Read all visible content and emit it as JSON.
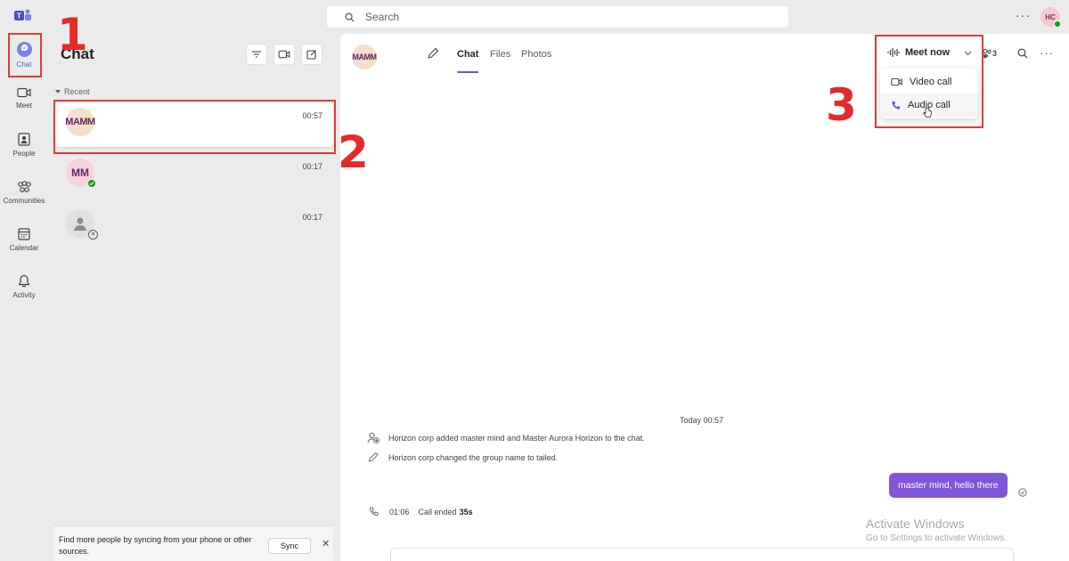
{
  "search": {
    "placeholder": "Search"
  },
  "top": {
    "more_label": "···",
    "user_initials": "HC"
  },
  "rail": [
    {
      "label": "Chat"
    },
    {
      "label": "Meet"
    },
    {
      "label": "People"
    },
    {
      "label": "Communities"
    },
    {
      "label": "Calendar"
    },
    {
      "label": "Activity"
    }
  ],
  "list": {
    "title": "Chat",
    "section": "Recent",
    "items": [
      {
        "avatar": "MAMM",
        "time": "00:57"
      },
      {
        "avatar": "MM",
        "time": "00:17"
      },
      {
        "avatar": "",
        "time": "00:17"
      }
    ],
    "sync_text": "Find more people by syncing from your phone or other sources.",
    "sync_button": "Sync",
    "sync_close": "✕"
  },
  "main": {
    "avatar": "MAMM",
    "tabs": [
      "Chat",
      "Files",
      "Photos"
    ],
    "meet_now": "Meet now",
    "participants": "3",
    "more_label": "···",
    "dropdown": [
      "Video call",
      "Audio call"
    ],
    "day_label": "Today 00:57",
    "system_messages": [
      "Horizon corp added master mind and Master Aurora Horizon to the chat.",
      "Horizon corp changed the group name to tailed."
    ],
    "bubble": "master mind, hello there",
    "call_time": "01:06",
    "call_text": "Call ended",
    "call_duration": "35s"
  },
  "watermark": {
    "title": "Activate Windows",
    "subtitle": "Go to Settings to activate Windows."
  },
  "annotations": [
    "1",
    "2",
    "3"
  ],
  "colors": {
    "accent": "#5b5fc7",
    "bubble": "#7f56d9",
    "highlight": "#e53935",
    "online": "#13a10e"
  }
}
